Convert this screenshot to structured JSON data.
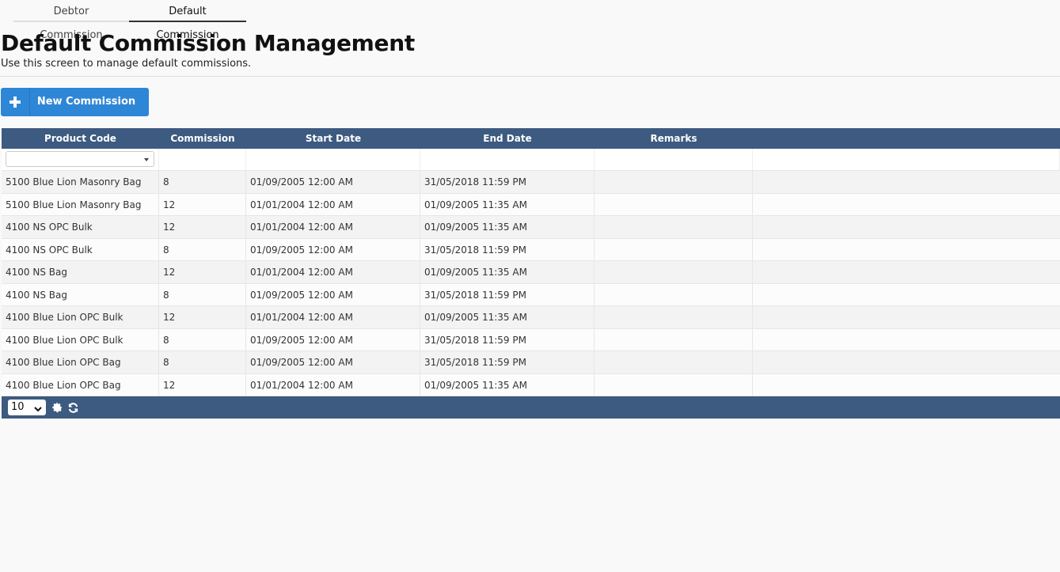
{
  "tabs": [
    {
      "label": "Debtor Commission",
      "active": false
    },
    {
      "label": "Default Commission",
      "active": true
    }
  ],
  "page": {
    "title": "Default Commission Management",
    "subtitle": "Use this screen to manage default commissions."
  },
  "toolbar": {
    "new_label": "New Commission",
    "new_icon": "plus-icon"
  },
  "grid": {
    "columns": [
      "Product Code",
      "Commission",
      "Start Date",
      "End Date",
      "Remarks"
    ],
    "filter": {
      "product_code": ""
    },
    "rows": [
      {
        "product_code": "5100 Blue Lion Masonry Bag",
        "commission": "8",
        "start_date": "01/09/2005 12:00 AM",
        "end_date": "31/05/2018 11:59 PM",
        "remarks": ""
      },
      {
        "product_code": "5100 Blue Lion Masonry Bag",
        "commission": "12",
        "start_date": "01/01/2004 12:00 AM",
        "end_date": "01/09/2005 11:35 AM",
        "remarks": ""
      },
      {
        "product_code": "4100 NS OPC Bulk",
        "commission": "12",
        "start_date": "01/01/2004 12:00 AM",
        "end_date": "01/09/2005 11:35 AM",
        "remarks": ""
      },
      {
        "product_code": "4100 NS OPC Bulk",
        "commission": "8",
        "start_date": "01/09/2005 12:00 AM",
        "end_date": "31/05/2018 11:59 PM",
        "remarks": ""
      },
      {
        "product_code": "4100 NS Bag",
        "commission": "12",
        "start_date": "01/01/2004 12:00 AM",
        "end_date": "01/09/2005 11:35 AM",
        "remarks": ""
      },
      {
        "product_code": "4100 NS Bag",
        "commission": "8",
        "start_date": "01/09/2005 12:00 AM",
        "end_date": "31/05/2018 11:59 PM",
        "remarks": ""
      },
      {
        "product_code": "4100 Blue Lion OPC Bulk",
        "commission": "12",
        "start_date": "01/01/2004 12:00 AM",
        "end_date": "01/09/2005 11:35 AM",
        "remarks": ""
      },
      {
        "product_code": "4100 Blue Lion OPC Bulk",
        "commission": "8",
        "start_date": "01/09/2005 12:00 AM",
        "end_date": "31/05/2018 11:59 PM",
        "remarks": ""
      },
      {
        "product_code": "4100 Blue Lion OPC Bag",
        "commission": "8",
        "start_date": "01/09/2005 12:00 AM",
        "end_date": "31/05/2018 11:59 PM",
        "remarks": ""
      },
      {
        "product_code": "4100 Blue Lion OPC Bag",
        "commission": "12",
        "start_date": "01/01/2004 12:00 AM",
        "end_date": "01/09/2005 11:35 AM",
        "remarks": ""
      }
    ]
  },
  "footer": {
    "page_size": "10",
    "settings_icon": "gear-icon",
    "refresh_icon": "refresh-icon"
  },
  "colors": {
    "header_bg": "#3d5a80",
    "button_bg": "#2e86d6"
  }
}
